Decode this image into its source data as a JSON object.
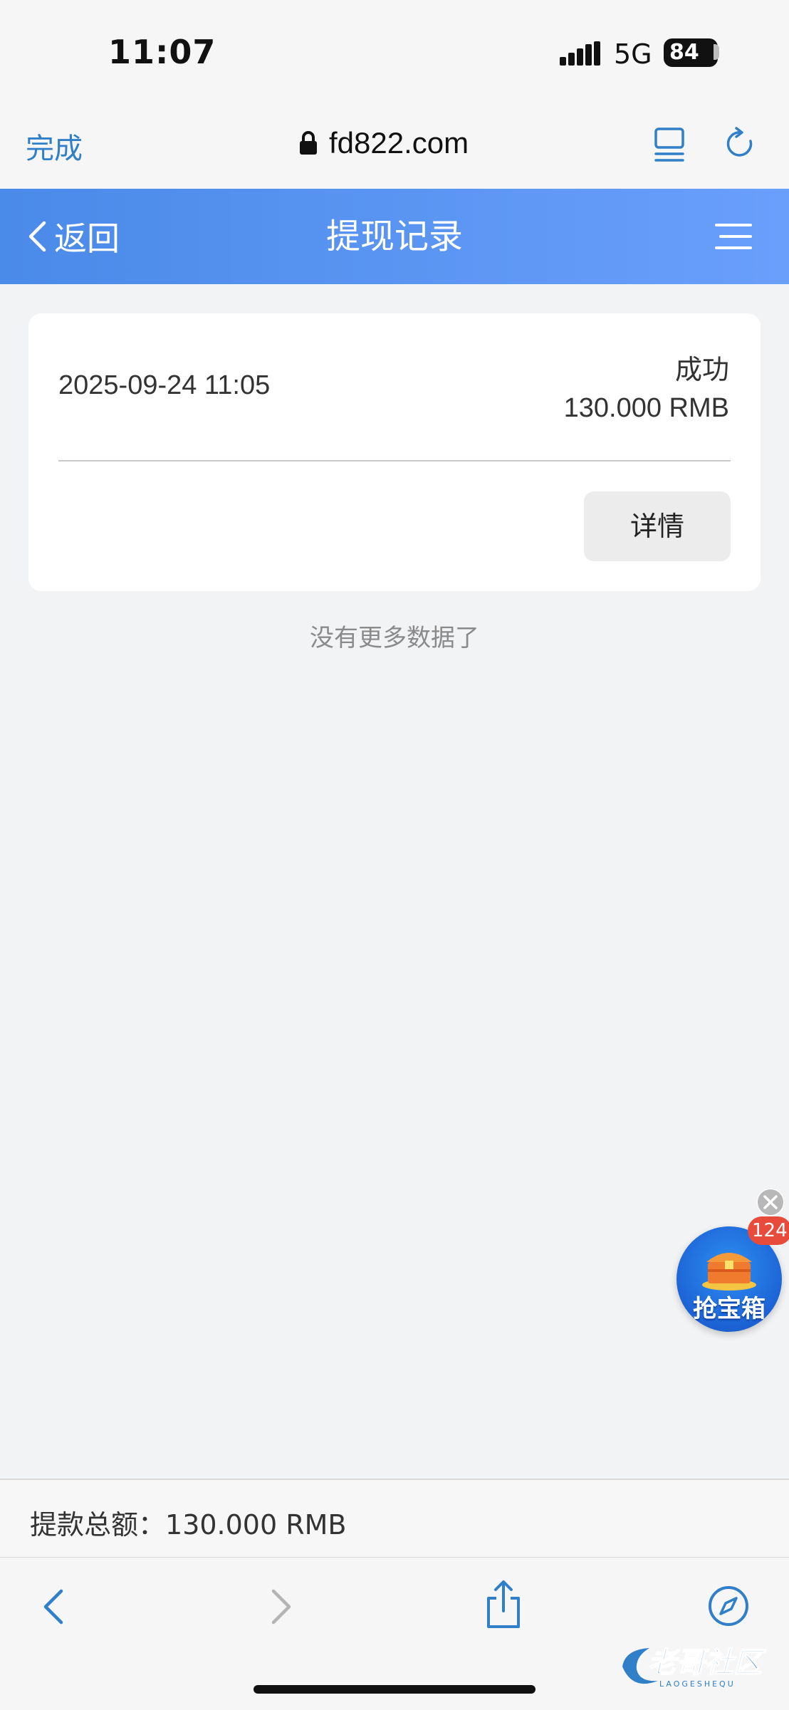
{
  "status_bar": {
    "time": "11:07",
    "network": "5G",
    "battery": "84"
  },
  "browser": {
    "done_label": "完成",
    "url": "fd822.com"
  },
  "header": {
    "back_label": "返回",
    "title": "提现记录"
  },
  "records": [
    {
      "datetime": "2025-09-24 11:05",
      "status": "成功",
      "amount": "130.000 RMB",
      "detail_label": "详情"
    }
  ],
  "list_end_text": "没有更多数据了",
  "floating": {
    "label": "抢宝箱",
    "badge": "124"
  },
  "footer": {
    "total_label": "提款总额：",
    "total_value": "130.000 RMB"
  },
  "watermark": {
    "text": "老哥社区",
    "subtext": "LAOGESHEQU"
  },
  "colors": {
    "header_start": "#4a8ae8",
    "header_end": "#6a9ffc",
    "link": "#2f7fc9",
    "badge": "#e84a3b"
  }
}
